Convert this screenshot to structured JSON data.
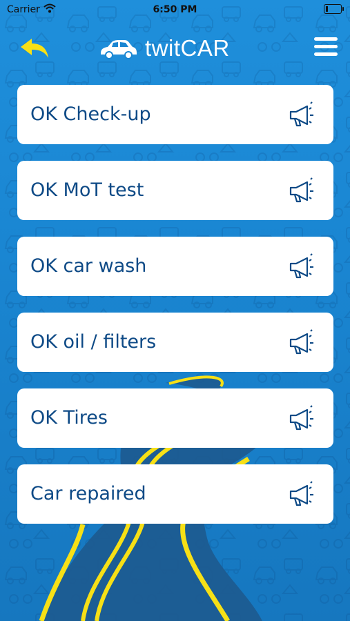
{
  "status_bar": {
    "carrier": "Carrier",
    "time": "6:50 PM"
  },
  "header": {
    "title": "twitCAR",
    "back_icon": "back-arrow-icon",
    "menu_icon": "hamburger-menu-icon",
    "logo_icon": "car-icon"
  },
  "items": [
    {
      "label": "OK Check-up",
      "icon": "megaphone-icon"
    },
    {
      "label": "OK MoT test",
      "icon": "megaphone-icon"
    },
    {
      "label": "OK car wash",
      "icon": "megaphone-icon"
    },
    {
      "label": "OK oil / filters",
      "icon": "megaphone-icon"
    },
    {
      "label": "OK Tires",
      "icon": "megaphone-icon"
    },
    {
      "label": "Car repaired",
      "icon": "megaphone-icon"
    }
  ],
  "colors": {
    "background": "#1a86d2",
    "accent_yellow": "#f7e016",
    "label_text": "#0e4a86",
    "card": "#ffffff"
  }
}
